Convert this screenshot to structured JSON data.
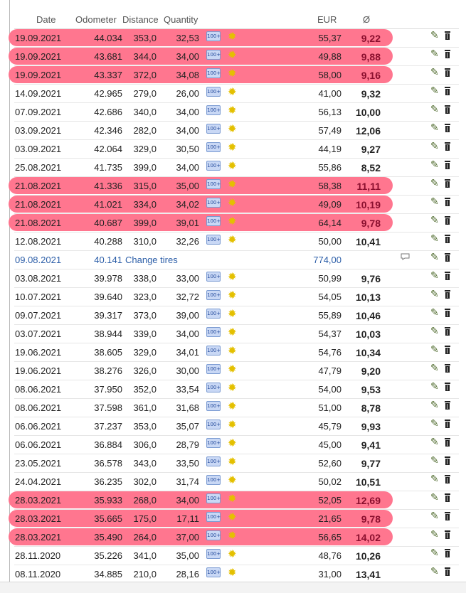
{
  "columns": [
    "Date",
    "Odometer",
    "Distance",
    "Quantity",
    "",
    "EUR",
    "Ø"
  ],
  "rows": [
    {
      "date": "19.09.2021",
      "odometer": "44.034",
      "distance": "353,0",
      "quantity": "32,53",
      "eur": "55,37",
      "avg": "9,22",
      "highlight": true
    },
    {
      "date": "19.09.2021",
      "odometer": "43.681",
      "distance": "344,0",
      "quantity": "34,00",
      "eur": "49,88",
      "avg": "9,88",
      "highlight": true
    },
    {
      "date": "19.09.2021",
      "odometer": "43.337",
      "distance": "372,0",
      "quantity": "34,08",
      "eur": "58,00",
      "avg": "9,16",
      "highlight": true
    },
    {
      "date": "14.09.2021",
      "odometer": "42.965",
      "distance": "279,0",
      "quantity": "26,00",
      "eur": "41,00",
      "avg": "9,32",
      "highlight": false
    },
    {
      "date": "07.09.2021",
      "odometer": "42.686",
      "distance": "340,0",
      "quantity": "34,00",
      "eur": "56,13",
      "avg": "10,00",
      "highlight": false
    },
    {
      "date": "03.09.2021",
      "odometer": "42.346",
      "distance": "282,0",
      "quantity": "34,00",
      "eur": "57,49",
      "avg": "12,06",
      "highlight": false
    },
    {
      "date": "03.09.2021",
      "odometer": "42.064",
      "distance": "329,0",
      "quantity": "30,50",
      "eur": "44,19",
      "avg": "9,27",
      "highlight": false
    },
    {
      "date": "25.08.2021",
      "odometer": "41.735",
      "distance": "399,0",
      "quantity": "34,00",
      "eur": "55,86",
      "avg": "8,52",
      "highlight": false
    },
    {
      "date": "21.08.2021",
      "odometer": "41.336",
      "distance": "315,0",
      "quantity": "35,00",
      "eur": "58,38",
      "avg": "11,11",
      "highlight": true
    },
    {
      "date": "21.08.2021",
      "odometer": "41.021",
      "distance": "334,0",
      "quantity": "34,02",
      "eur": "49,09",
      "avg": "10,19",
      "highlight": true
    },
    {
      "date": "21.08.2021",
      "odometer": "40.687",
      "distance": "399,0",
      "quantity": "39,01",
      "eur": "64,14",
      "avg": "9,78",
      "highlight": true
    },
    {
      "date": "12.08.2021",
      "odometer": "40.288",
      "distance": "310,0",
      "quantity": "32,26",
      "eur": "50,00",
      "avg": "10,41",
      "highlight": false
    },
    {
      "date": "09.08.2021",
      "odometer": "40.141",
      "note": "Change tires",
      "eur": "774,00",
      "avg": "",
      "highlight": false,
      "service": true
    },
    {
      "date": "03.08.2021",
      "odometer": "39.978",
      "distance": "338,0",
      "quantity": "33,00",
      "eur": "50,99",
      "avg": "9,76",
      "highlight": false
    },
    {
      "date": "10.07.2021",
      "odometer": "39.640",
      "distance": "323,0",
      "quantity": "32,72",
      "eur": "54,05",
      "avg": "10,13",
      "highlight": false
    },
    {
      "date": "09.07.2021",
      "odometer": "39.317",
      "distance": "373,0",
      "quantity": "39,00",
      "eur": "55,89",
      "avg": "10,46",
      "highlight": false
    },
    {
      "date": "03.07.2021",
      "odometer": "38.944",
      "distance": "339,0",
      "quantity": "34,00",
      "eur": "54,37",
      "avg": "10,03",
      "highlight": false
    },
    {
      "date": "19.06.2021",
      "odometer": "38.605",
      "distance": "329,0",
      "quantity": "34,01",
      "eur": "54,76",
      "avg": "10,34",
      "highlight": false
    },
    {
      "date": "19.06.2021",
      "odometer": "38.276",
      "distance": "326,0",
      "quantity": "30,00",
      "eur": "47,79",
      "avg": "9,20",
      "highlight": false
    },
    {
      "date": "08.06.2021",
      "odometer": "37.950",
      "distance": "352,0",
      "quantity": "33,54",
      "eur": "54,00",
      "avg": "9,53",
      "highlight": false
    },
    {
      "date": "08.06.2021",
      "odometer": "37.598",
      "distance": "361,0",
      "quantity": "31,68",
      "eur": "51,00",
      "avg": "8,78",
      "highlight": false
    },
    {
      "date": "06.06.2021",
      "odometer": "37.237",
      "distance": "353,0",
      "quantity": "35,07",
      "eur": "45,79",
      "avg": "9,93",
      "highlight": false
    },
    {
      "date": "06.06.2021",
      "odometer": "36.884",
      "distance": "306,0",
      "quantity": "28,79",
      "eur": "45,00",
      "avg": "9,41",
      "highlight": false
    },
    {
      "date": "23.05.2021",
      "odometer": "36.578",
      "distance": "343,0",
      "quantity": "33,50",
      "eur": "52,60",
      "avg": "9,77",
      "highlight": false
    },
    {
      "date": "24.04.2021",
      "odometer": "36.235",
      "distance": "302,0",
      "quantity": "31,74",
      "eur": "50,02",
      "avg": "10,51",
      "highlight": false
    },
    {
      "date": "28.03.2021",
      "odometer": "35.933",
      "distance": "268,0",
      "quantity": "34,00",
      "eur": "52,05",
      "avg": "12,69",
      "highlight": true
    },
    {
      "date": "28.03.2021",
      "odometer": "35.665",
      "distance": "175,0",
      "quantity": "17,11",
      "eur": "21,65",
      "avg": "9,78",
      "highlight": true
    },
    {
      "date": "28.03.2021",
      "odometer": "35.490",
      "distance": "264,0",
      "quantity": "37,00",
      "eur": "56,65",
      "avg": "14,02",
      "highlight": true
    },
    {
      "date": "28.11.2020",
      "odometer": "35.226",
      "distance": "341,0",
      "quantity": "35,00",
      "eur": "48,76",
      "avg": "10,26",
      "highlight": false
    },
    {
      "date": "08.11.2020",
      "odometer": "34.885",
      "distance": "210,0",
      "quantity": "28,16",
      "eur": "31,00",
      "avg": "13,41",
      "highlight": false
    }
  ],
  "icons": {
    "full_tank_badge": "100+",
    "sun": "sun-icon",
    "edit": "pencil-icon",
    "delete": "trash-icon",
    "comment": "comment-icon"
  }
}
